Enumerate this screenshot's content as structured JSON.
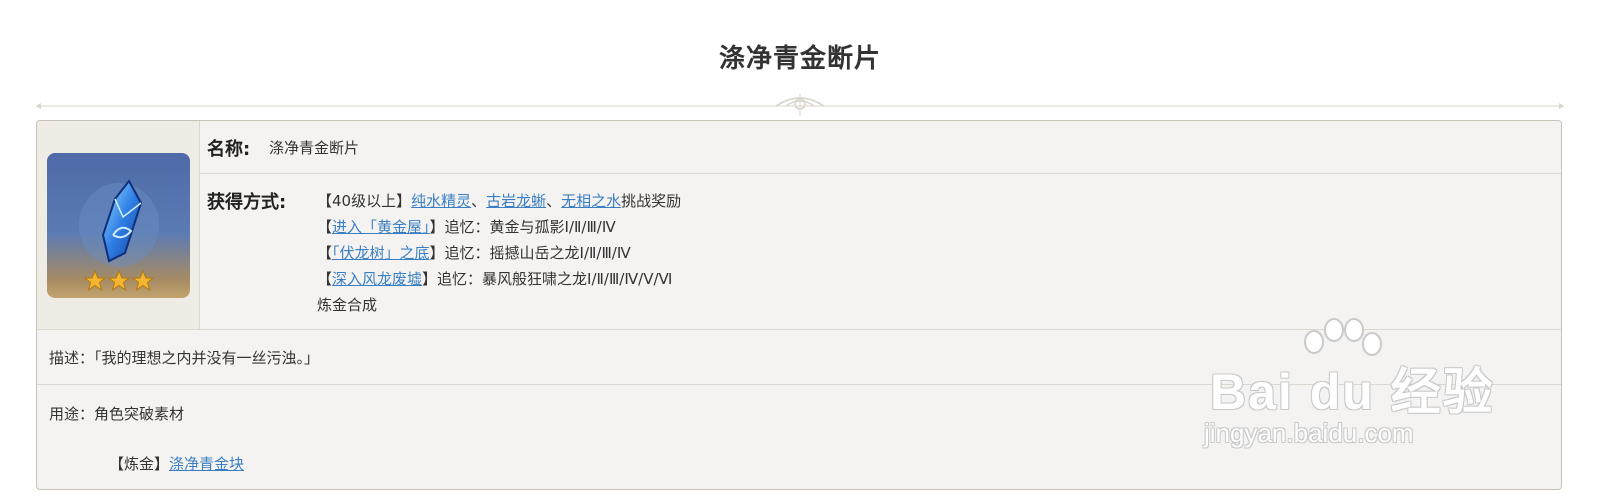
{
  "page": {
    "title": "涤净青金断片"
  },
  "item": {
    "name_label": "名称:",
    "name_value": "涤净青金断片",
    "rarity_stars": 3,
    "obtain_label": "获得方式:",
    "obtain": {
      "line1": {
        "prefix": "【40级以上】",
        "link1": "纯水精灵",
        "sep1": "、",
        "link2": "古岩龙蜥",
        "sep2": "、",
        "link3": "无相之水",
        "suffix": "挑战奖励"
      },
      "line2": {
        "prefix": "【",
        "link": "进入「黄金屋」",
        "suffix": "】追忆：黄金与孤影Ⅰ/Ⅱ/Ⅲ/Ⅳ"
      },
      "line3": {
        "prefix": "【",
        "link": "「伏龙树」之底",
        "suffix": "】追忆：摇撼山岳之龙Ⅰ/Ⅱ/Ⅲ/Ⅳ"
      },
      "line4": {
        "prefix": "【",
        "link": "深入风龙废墟",
        "suffix": "】追忆：暴风般狂啸之龙Ⅰ/Ⅱ/Ⅲ/Ⅳ/Ⅴ/Ⅵ"
      },
      "line5": "炼金合成"
    },
    "description": "描述：「我的理想之内并没有一丝污浊。」",
    "usage": "用途：角色突破素材",
    "usage_alchemy": {
      "prefix": "【炼金】",
      "link": "涤净青金块"
    }
  },
  "watermark": {
    "brand": "Bai du 经验",
    "url": "jingyan.baidu.com"
  },
  "colors": {
    "link": "#3a7fc4",
    "card_bg": "#f4f3f1",
    "border": "#c9c2b6",
    "star": "#f2b431"
  }
}
